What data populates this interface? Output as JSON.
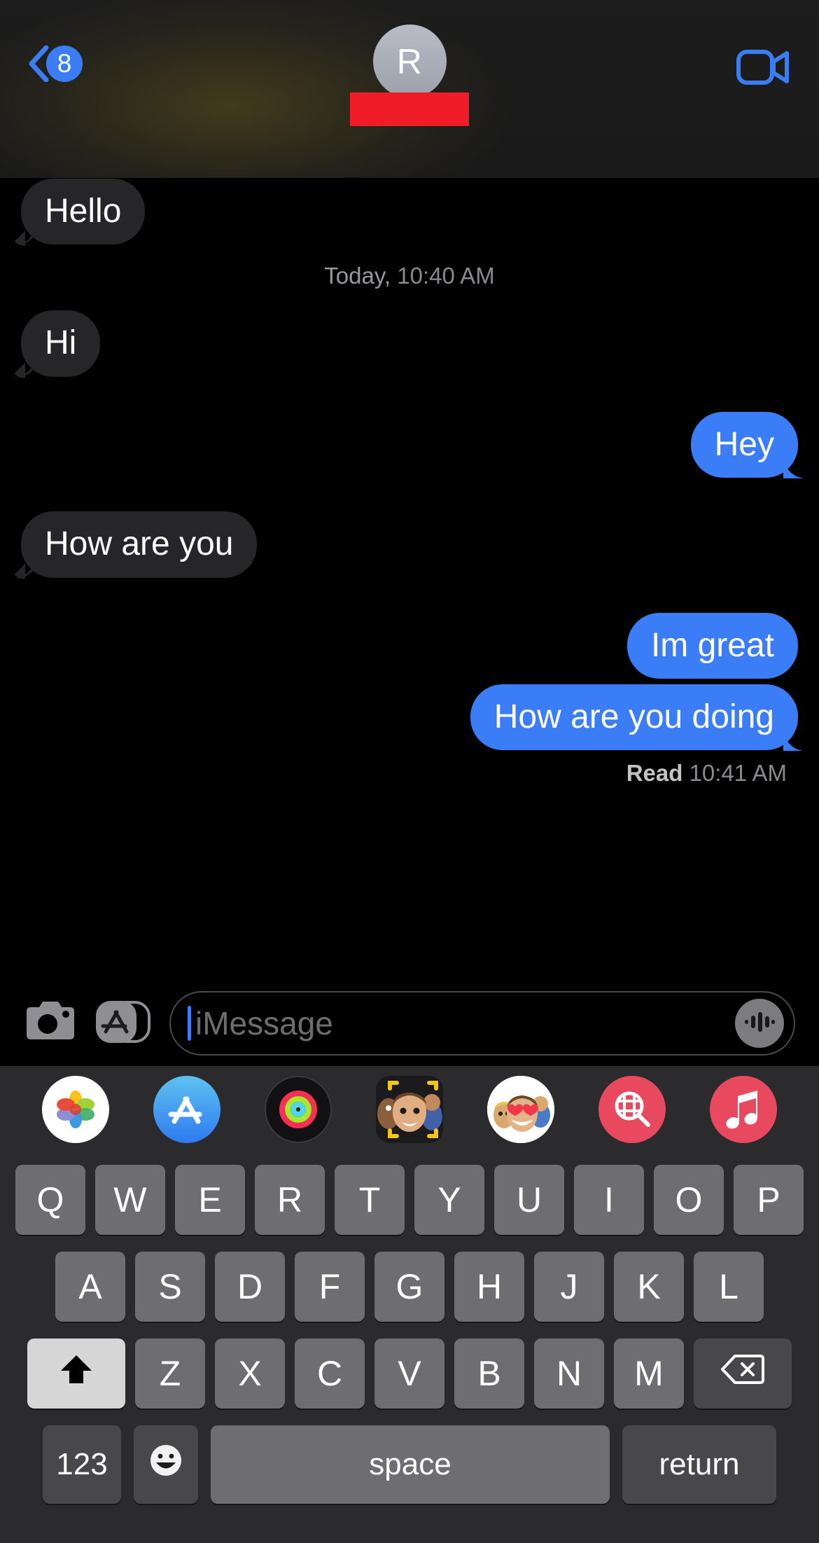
{
  "navbar": {
    "back_label": "back-chevron",
    "unread_count": "8",
    "avatar_initial": "R",
    "contact_name_redacted": "",
    "facetime_label": "FaceTime video"
  },
  "conversation": {
    "day_divider": {
      "day": "Today,",
      "time": "10:40 AM"
    },
    "messages": [
      {
        "text": "Hello",
        "side": "in",
        "tail": true
      },
      {
        "text": "Hi",
        "side": "in",
        "tail": true
      },
      {
        "text": "Hey",
        "side": "out",
        "tail": true
      },
      {
        "text": "How are you",
        "side": "in",
        "tail": true
      },
      {
        "text": "Im great",
        "side": "out",
        "tail": false
      },
      {
        "text": "How are you doing",
        "side": "out",
        "tail": true
      }
    ],
    "read_receipt": {
      "label": "Read",
      "time": "10:41 AM"
    }
  },
  "input_bar": {
    "camera_icon": "camera-icon",
    "appstore_icon": "app-store-icon",
    "placeholder": "iMessage",
    "audio_icon": "audio-waveform-icon"
  },
  "app_drawer": {
    "apps": [
      {
        "name": "photos-app-icon",
        "label": "Photos"
      },
      {
        "name": "app-store-app-icon",
        "label": "App Store"
      },
      {
        "name": "fitness-app-icon",
        "label": "Fitness"
      },
      {
        "name": "memoji-app-icon",
        "label": "Memoji"
      },
      {
        "name": "memoji-stickers-app-icon",
        "label": "Memoji Stickers"
      },
      {
        "name": "images-search-app-icon",
        "label": "#images"
      },
      {
        "name": "apple-music-app-icon",
        "label": "Music"
      }
    ]
  },
  "keyboard": {
    "row1": [
      "Q",
      "W",
      "E",
      "R",
      "T",
      "Y",
      "U",
      "I",
      "O",
      "P"
    ],
    "row2": [
      "A",
      "S",
      "D",
      "F",
      "G",
      "H",
      "J",
      "K",
      "L"
    ],
    "row3": [
      "Z",
      "X",
      "C",
      "V",
      "B",
      "N",
      "M"
    ],
    "shift_label": "shift-key",
    "delete_label": "delete-key",
    "numeric_label": "123",
    "emoji_label": "emoji-key",
    "space_label": "space",
    "return_label": "return"
  },
  "colors": {
    "outgoing_bubble": "#3B7DF6",
    "incoming_bubble": "#262628",
    "accent_blue": "#3B7DF6",
    "redaction_red": "#F01C28",
    "keyboard_bg": "#2b2b2d",
    "key_light": "#6e6e71",
    "key_dark": "#48484b"
  }
}
